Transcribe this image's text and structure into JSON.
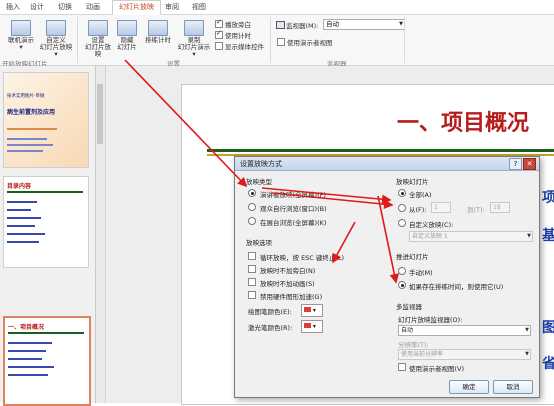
{
  "tabs": [
    "插入",
    "设计",
    "切换",
    "动画",
    "幻灯片放映",
    "审阅",
    "视图"
  ],
  "ribbon": {
    "buttons": [
      {
        "label": "联机演示",
        "sub": "▾"
      },
      {
        "label": "自定义",
        "sub": "幻灯片放映 ▾"
      },
      {
        "label": "设置",
        "sub": "幻灯片放映"
      },
      {
        "label": "隐藏",
        "sub": "幻灯片"
      },
      {
        "label": "排练计时",
        "sub": ""
      },
      {
        "label": "录制",
        "sub": "幻灯片演示 ▾"
      }
    ],
    "checkboxes": [
      {
        "label": "播放旁白",
        "checked": true
      },
      {
        "label": "使用计时",
        "checked": true
      },
      {
        "label": "显示媒体控件",
        "checked": false
      }
    ],
    "monitor_label": "监视器(M):",
    "monitor_value": "自动",
    "presenter_view_label": "使用演示者视图",
    "groups": [
      "开始放映幻灯片",
      "设置",
      "监视器"
    ]
  },
  "thumbs": {
    "slide1_lines": [
      "技术实用图片·单微",
      "病生前置剂及应用"
    ],
    "slide2_title": "目录内容",
    "slide3_title": "一、项目概况"
  },
  "slide": {
    "title": "一、项目概况"
  },
  "dialog": {
    "title": "设置放映方式",
    "help": "?",
    "close": "✕",
    "show_type": {
      "label": "放映类型",
      "options": [
        {
          "label": "演讲者放映(全屏幕)(P)",
          "selected": true
        },
        {
          "label": "观众自行浏览(窗口)(B)",
          "selected": false
        },
        {
          "label": "在展台浏览(全屏幕)(K)",
          "selected": false
        }
      ]
    },
    "show_options": {
      "label": "放映选项",
      "items": [
        {
          "label": "循环放映，按 ESC 键终止(L)",
          "checked": false
        },
        {
          "label": "放映时不加旁白(N)",
          "checked": false
        },
        {
          "label": "放映时不加动画(S)",
          "checked": false
        },
        {
          "label": "禁用硬件图形加速(G)",
          "checked": false
        }
      ]
    },
    "pen_color_label": "绘图笔颜色(E):",
    "laser_color_label": "激光笔颜色(R):",
    "colors": {
      "pen": "#e53935",
      "laser": "#e53935"
    },
    "slides": {
      "label": "放映幻灯片",
      "all": "全部(A)",
      "from": "从(F):",
      "from_value": "1",
      "to": "到(T):",
      "to_value": "18",
      "custom": "自定义放映(C):",
      "custom_value": "自定义放映 1"
    },
    "advance": {
      "label": "推进幻灯片",
      "manual": "手动(M)",
      "timings": "如果存在排练时间，则使用它(U)"
    },
    "monitors": {
      "label": "多监视器",
      "show_on_label": "幻灯片放映监视器(O):",
      "show_on_value": "自动",
      "resolution_label": "分辨率(T):",
      "resolution_value": "使用当前分辨率",
      "presenter_view": "使用演示者视图(V)"
    },
    "ok": "确定",
    "cancel": "取消"
  },
  "slide_side_chars": [
    "项",
    "基",
    "图",
    "省"
  ]
}
